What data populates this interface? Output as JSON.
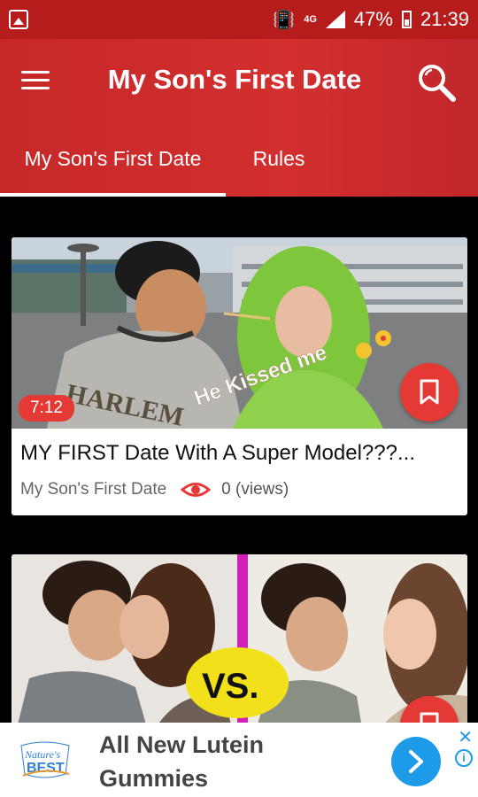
{
  "status_bar": {
    "network": "4G",
    "battery": "47%",
    "time": "21:39"
  },
  "app_bar": {
    "title": "My Son's First Date",
    "menu_icon": "hamburger-menu-icon",
    "search_icon": "search-icon"
  },
  "tabs": [
    {
      "label": "My Son's First Date",
      "selected": true
    },
    {
      "label": "Rules",
      "selected": false
    }
  ],
  "videos": [
    {
      "duration": "7:12",
      "title": "MY FIRST Date With A Super Model???...",
      "channel": "My Son's First Date",
      "views": "0 (views)",
      "thumb_caption": "He Kissed me",
      "thumb_shirt_text": "HARLEM",
      "bookmark_icon": "bookmark-icon"
    },
    {
      "duration": "",
      "title": "",
      "thumb_caption": "VS.",
      "bookmark_icon": "bookmark-icon"
    }
  ],
  "ad": {
    "logo_text": "Nature's Best",
    "line1": "All New Lutein",
    "line2": "Gummies",
    "close_label": "✕",
    "info_label": "i"
  },
  "colors": {
    "primary": "#c62828",
    "accent": "#e53935",
    "ad_blue": "#1e9be8"
  }
}
